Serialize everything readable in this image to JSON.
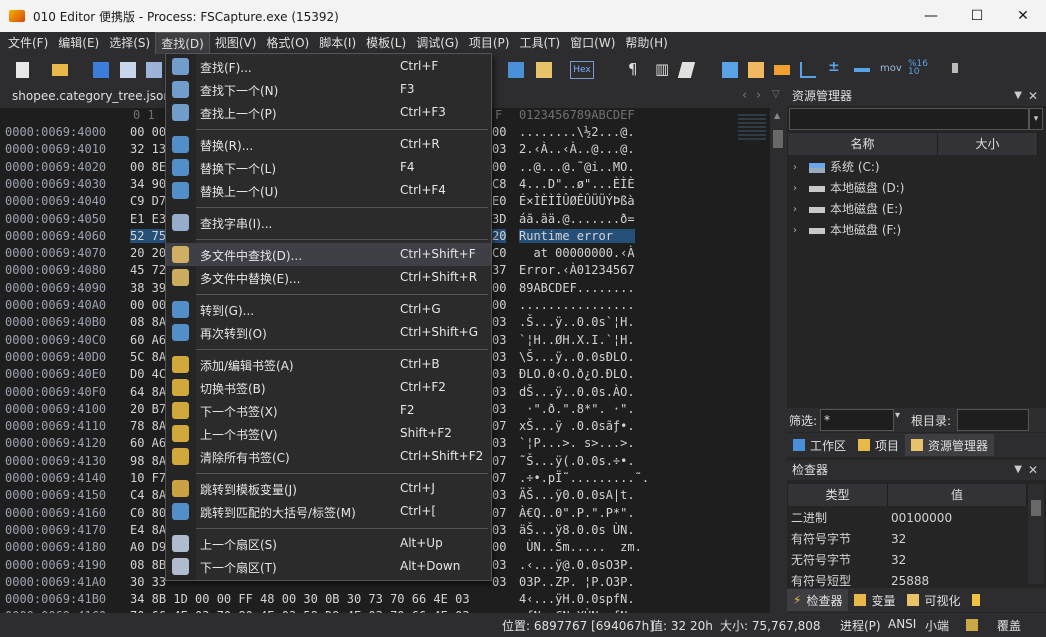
{
  "window": {
    "title": "010 Editor 便携版 - Process: FSCapture.exe (15392)",
    "minimize": "—",
    "maximize": "☐",
    "close": "✕"
  },
  "menu": [
    "文件(F)",
    "编辑(E)",
    "选择(S)",
    "查找(D)",
    "视图(V)",
    "格式(O)",
    "脚本(I)",
    "模板(L)",
    "调试(G)",
    "项目(P)",
    "工具(T)",
    "窗口(W)",
    "帮助(H)"
  ],
  "doc_tab": {
    "name": "shopee.category_tree.json"
  },
  "hex": {
    "header_left": "0   1",
    "header_right": "F",
    "header_ascii": "0123456789ABCDEF",
    "rows": [
      {
        "addr": "0000:0069:4000",
        "l": "00 00",
        "r": "00",
        "a": "........\\½2...@."
      },
      {
        "addr": "0000:0069:4010",
        "l": "32 13",
        "r": "03",
        "a": "2.‹À..‹À..@...@."
      },
      {
        "addr": "0000:0069:4020",
        "l": "00 8E",
        "r": "00",
        "a": "..@...@.˜@i..MO."
      },
      {
        "addr": "0000:0069:4030",
        "l": "34 90",
        "r": "C8",
        "a": "4...D\"..ø\"...ÈÌÈ"
      },
      {
        "addr": "0000:0069:4040",
        "l": "C9 D7",
        "r": "E0",
        "a": "É×ÌÈÌÎÛØÊÛÜÜÝÞßà"
      },
      {
        "addr": "0000:0069:4050",
        "l": "E1 E3",
        "r": "3D",
        "a": "áã.ää.@.......ð="
      },
      {
        "addr": "0000:0069:4060",
        "l": "52 75",
        "r": "20",
        "a": "Runtime error   ",
        "sel": true
      },
      {
        "addr": "0000:0069:4070",
        "l": "20 20",
        "r": "C0",
        "a": "  at 00000000.‹À"
      },
      {
        "addr": "0000:0069:4080",
        "l": "45 72",
        "r": "37",
        "a": "Error.‹À01234567"
      },
      {
        "addr": "0000:0069:4090",
        "l": "38 39",
        "r": "00",
        "a": "89ABCDEF........"
      },
      {
        "addr": "0000:0069:40A0",
        "l": "00 00",
        "r": "00",
        "a": "................"
      },
      {
        "addr": "0000:0069:40B0",
        "l": "08 8A",
        "r": "03",
        "a": ".Š...ÿ..0.0s`¦H."
      },
      {
        "addr": "0000:0069:40C0",
        "l": "60 A6",
        "r": "03",
        "a": "`¦H..ØH.X.I.`¦H."
      },
      {
        "addr": "0000:0069:40D0",
        "l": "5C 8A",
        "r": "03",
        "a": "\\Š...ÿ..0.0sÐLO."
      },
      {
        "addr": "0000:0069:40E0",
        "l": "D0 4C",
        "r": "03",
        "a": "ÐLO.0‹O.ð¿O.ÐLO."
      },
      {
        "addr": "0000:0069:40F0",
        "l": "64 8A",
        "r": "03",
        "a": "dŠ...ÿ..0.0s.ÀO."
      },
      {
        "addr": "0000:0069:4100",
        "l": "20 B7",
        "r": "03",
        "a": " ·\".ð.\".8*\". ·\"."
      },
      {
        "addr": "0000:0069:4110",
        "l": "78 8A",
        "r": "07",
        "a": "xŠ...ÿ .0.0sãƒ•."
      },
      {
        "addr": "0000:0069:4120",
        "l": "60 A6",
        "r": "03",
        "a": "`¦P...>. s>...>."
      },
      {
        "addr": "0000:0069:4130",
        "l": "98 8A",
        "r": "07",
        "a": "˜Š...ÿ(.0.0s.÷•."
      },
      {
        "addr": "0000:0069:4140",
        "l": "10 F7",
        "r": "07",
        "a": ".÷•.pÏ˜.........˜."
      },
      {
        "addr": "0000:0069:4150",
        "l": "C4 8A",
        "r": "03",
        "a": "ÄŠ...ÿ0.0.0sA|t."
      },
      {
        "addr": "0000:0069:4160",
        "l": "C0 80",
        "r": "07",
        "a": "À€Q..0\".P.\".P*\"."
      },
      {
        "addr": "0000:0069:4170",
        "l": "E4 8A",
        "r": "03",
        "a": "äŠ...ÿ8.0.0s ÙN."
      },
      {
        "addr": "0000:0069:4180",
        "l": "A0 D9",
        "r": "00",
        "a": " ÙN..Šm.....  zm."
      },
      {
        "addr": "0000:0069:4190",
        "l": "08 8B",
        "r": "03",
        "a": ".‹...ÿ@.0.0sO3P."
      },
      {
        "addr": "0000:0069:41A0",
        "l": "30 33",
        "r": "03",
        "a": "03P..ZP. ¦P.O3P."
      },
      {
        "addr": "0000:0069:41B0",
        "l": "34 8B 1D 00 00 FF 48 00 30 0B 30 73 70 66 4E 03",
        "r": "",
        "a": "4‹...ÿH.0.0spfN."
      },
      {
        "addr": "0000:0069:41C0",
        "l": "70 66 4E 03 70 80 4E 03 58 D9 4E 03 70 66 4E 03",
        "r": "",
        "a": "pfN.p€N.XÙN.pfN."
      }
    ]
  },
  "find_menu": {
    "items": [
      {
        "label": "查找(F)...",
        "shortcut": "Ctrl+F",
        "icon": "search-icon"
      },
      {
        "label": "查找下一个(N)",
        "shortcut": "F3",
        "icon": "search-next-icon"
      },
      {
        "label": "查找上一个(P)",
        "shortcut": "Ctrl+F3",
        "icon": "search-prev-icon"
      },
      {
        "label": "替换(R)...",
        "shortcut": "Ctrl+R",
        "icon": "replace-icon"
      },
      {
        "label": "替换下一个(L)",
        "shortcut": "F4",
        "icon": "replace-next-icon"
      },
      {
        "label": "替换上一个(U)",
        "shortcut": "Ctrl+F4",
        "icon": "replace-prev-icon"
      },
      {
        "label": "查找字串(I)...",
        "shortcut": "",
        "icon": "find-strings-icon"
      },
      {
        "label": "多文件中查找(D)...",
        "shortcut": "Ctrl+Shift+F",
        "icon": "find-in-files-icon"
      },
      {
        "label": "多文件中替换(E)...",
        "shortcut": "Ctrl+Shift+R",
        "icon": "replace-in-files-icon"
      },
      {
        "label": "转到(G)...",
        "shortcut": "Ctrl+G",
        "icon": "goto-icon"
      },
      {
        "label": "再次转到(O)",
        "shortcut": "Ctrl+Shift+G",
        "icon": "goto-again-icon"
      },
      {
        "label": "添加/编辑书签(A)",
        "shortcut": "Ctrl+B",
        "icon": "bookmark-add-icon"
      },
      {
        "label": "切换书签(B)",
        "shortcut": "Ctrl+F2",
        "icon": "bookmark-toggle-icon"
      },
      {
        "label": "下一个书签(X)",
        "shortcut": "F2",
        "icon": "bookmark-next-icon"
      },
      {
        "label": "上一个书签(V)",
        "shortcut": "Shift+F2",
        "icon": "bookmark-prev-icon"
      },
      {
        "label": "清除所有书签(C)",
        "shortcut": "Ctrl+Shift+F2",
        "icon": "bookmark-clear-icon"
      },
      {
        "label": "跳转到模板变量(J)",
        "shortcut": "Ctrl+J",
        "icon": "jump-template-var-icon"
      },
      {
        "label": "跳转到匹配的大括号/标签(M)",
        "shortcut": "Ctrl+[",
        "icon": "jump-brace-icon"
      },
      {
        "label": "上一个扇区(S)",
        "shortcut": "Alt+Up",
        "icon": "sector-prev-icon"
      },
      {
        "label": "下一个扇区(T)",
        "shortcut": "Alt+Down",
        "icon": "sector-next-icon"
      }
    ]
  },
  "explorer": {
    "title": "资源管理器",
    "col_name": "名称",
    "col_size": "大小",
    "drives": [
      "系统 (C:)",
      "本地磁盘 (D:)",
      "本地磁盘 (E:)",
      "本地磁盘 (F:)"
    ],
    "filter_label": "筛选:",
    "filter_value": "*",
    "root_label": "根目录:",
    "tabs": [
      "工作区",
      "项目",
      "资源管理器"
    ]
  },
  "inspector": {
    "title": "检查器",
    "col_type": "类型",
    "col_value": "值",
    "rows": [
      {
        "k": "二进制",
        "v": "00100000"
      },
      {
        "k": "有符号字节",
        "v": "32"
      },
      {
        "k": "无符号字节",
        "v": "32"
      },
      {
        "k": "有符号短型",
        "v": "25888"
      }
    ],
    "tabs": [
      "检查器",
      "变量",
      "可视化"
    ]
  },
  "status": {
    "position": "位置: 6897767 [694067h]",
    "value": "值: 32 20h",
    "size": "大小: 75,767,808",
    "process": "进程(P)",
    "encoding": "ANSI",
    "endian": "小端",
    "mode": "覆盖"
  },
  "toolbar": {
    "hex_label": "Hex",
    "mov_label": "mov"
  }
}
